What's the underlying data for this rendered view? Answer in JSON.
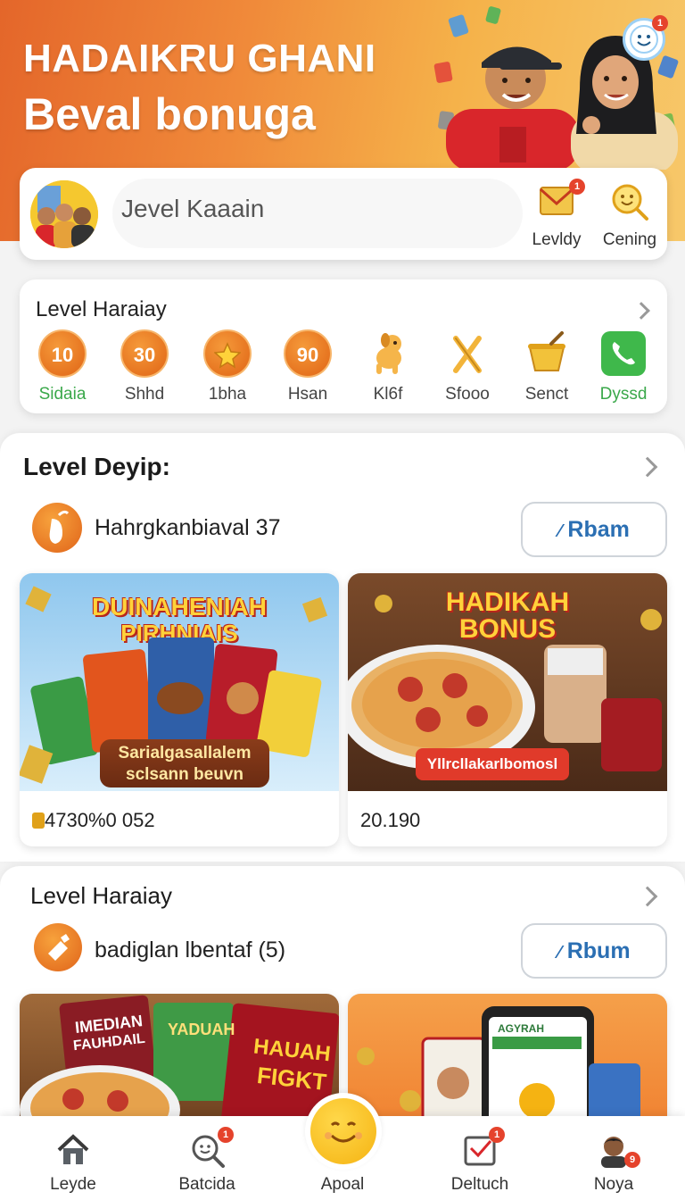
{
  "hero": {
    "title": "HADAIKRU GHANI",
    "subtitle": "Beval bonuga",
    "notification_count": "1"
  },
  "profile": {
    "name": "Jevel Kaaain",
    "actions": [
      {
        "label": "Levldy",
        "icon": "mail-icon",
        "badge": "1"
      },
      {
        "label": "Cening",
        "icon": "search-smile-icon"
      }
    ]
  },
  "level_card": {
    "title": "Level Haraiay",
    "items": [
      {
        "value": "10",
        "label": "Sidaia",
        "label_color": "#3aa84a"
      },
      {
        "value": "30",
        "label": "Shhd",
        "label_color": "#444444"
      },
      {
        "value": "",
        "icon": "star-icon",
        "label": "1bha",
        "label_color": "#444444"
      },
      {
        "value": "90",
        "label": "Hsan",
        "label_color": "#444444"
      },
      {
        "icon": "dog-icon",
        "label": "Kl6f",
        "label_color": "#444444"
      },
      {
        "icon": "cross-tools-icon",
        "label": "Sfooo",
        "label_color": "#444444"
      },
      {
        "icon": "bowl-icon",
        "label": "Senct",
        "label_color": "#444444"
      },
      {
        "icon": "phone-icon",
        "label": "Dyssd",
        "label_color": "#3aa84a"
      }
    ]
  },
  "section1": {
    "title": "Level Deyip:",
    "merchant": "Hahrgkanbiaval 37",
    "album_label": "Rbam",
    "cards": [
      {
        "headline1": "DUINAHENIAH",
        "headline2": "PIRHNIAIS",
        "ribbon1": "Sarialgasallalem",
        "ribbon2": "sclsann beuvn",
        "price": "4730%0 052"
      },
      {
        "headline1": "HADIKAH",
        "headline2": "BONUS",
        "ribbon1": "Yllrcllakarlbomosl",
        "price": "20.190"
      }
    ]
  },
  "section2": {
    "title": "Level Haraiay",
    "merchant": "badiglan lbentaf (5)",
    "album_label": "Rbum",
    "cards": [
      {
        "label1": "IMEDIAN",
        "label2": "FAUHDAIL",
        "label3": "YADUAH",
        "label4": "HAUAH",
        "label5": "FIGKT"
      },
      {
        "label1": "AGYRAH"
      }
    ]
  },
  "nav": {
    "items": [
      {
        "label": "Leyde",
        "icon": "home-icon"
      },
      {
        "label": "Batcida",
        "icon": "search-icon",
        "badge": "1"
      },
      {
        "label": "Apoal",
        "icon": "smile-icon"
      },
      {
        "label": "Deltuch",
        "icon": "inbox-icon",
        "badge": "1"
      },
      {
        "label": "Noya",
        "icon": "avatar-icon",
        "badge": "9"
      }
    ]
  },
  "colors": {
    "accent_orange": "#e8671c",
    "link_blue": "#2b6fb3",
    "green_label": "#3aa84a"
  }
}
